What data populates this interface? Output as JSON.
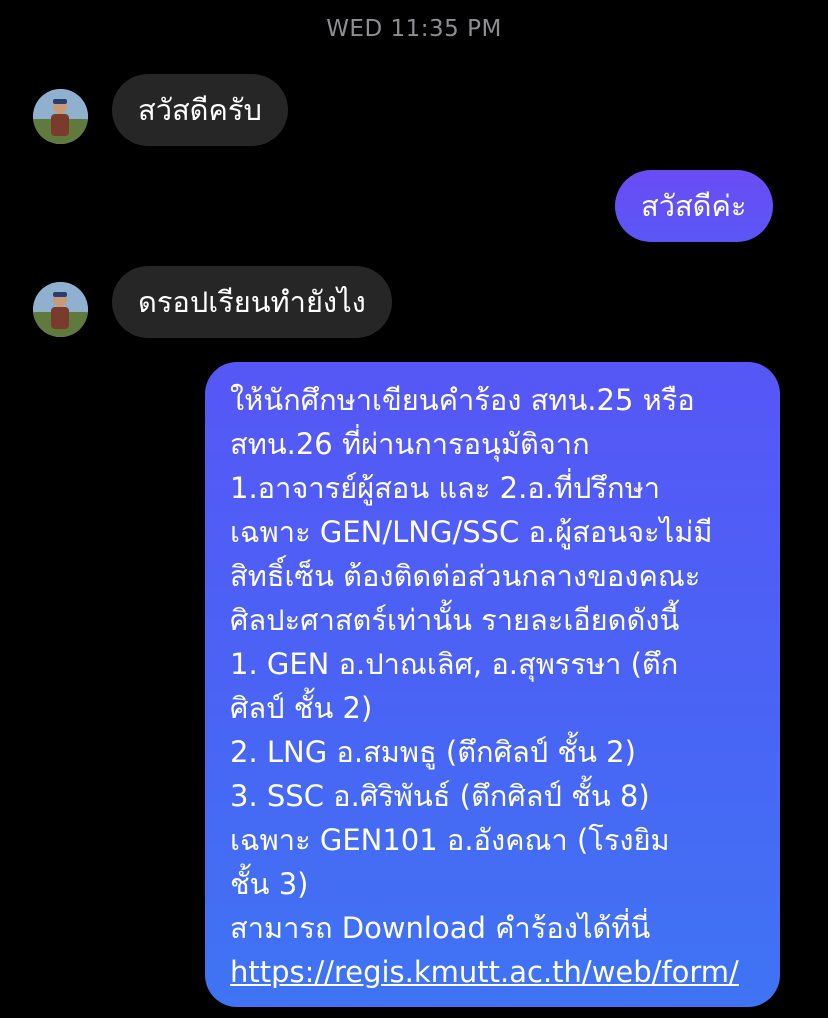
{
  "timestamp": "WED 11:35 PM",
  "messages": [
    {
      "sender": "other",
      "text": "สวัสดีครับ"
    },
    {
      "sender": "me",
      "text": "สวัสดีค่ะ"
    },
    {
      "sender": "other",
      "text": "ดรอปเรียนทำยังไง"
    },
    {
      "sender": "me",
      "lines": [
        " ให้นักศึกษาเขียนคำร้อง สทน.25 หรือ",
        "สทน.26 ที่ผ่านการอนุมัติจาก",
        "1.อาจารย์ผู้สอน และ 2.อ.ที่ปรึกษา",
        "เฉพาะ GEN/LNG/SSC อ.ผู้สอนจะไม่มี",
        "สิทธิ์เซ็น ต้องติดต่อส่วนกลางของคณะ",
        "ศิลปะศาสตร์เท่านั้น รายละเอียดดังนี้",
        "1. GEN อ.ปาณเลิศ, อ.สุพรรษา (ตึก",
        "ศิลป์ ชั้น 2)",
        "2. LNG อ.สมพธู (ตึกศิลป์ ชั้น 2)",
        "3. SSC อ.ศิริพันธ์ (ตึกศิลป์ ชั้น 8)",
        "เฉพาะ GEN101 อ.อังคณา (โรงยิม",
        "ชั้น 3)",
        "สามารถ Download คำร้องได้ที่นี่"
      ],
      "link": "https://regis.kmutt.ac.th/web/form/"
    }
  ],
  "colors": {
    "background": "#000000",
    "incoming_bubble": "#262626",
    "outgoing_gradient_top": "#6a4cf4",
    "outgoing_gradient_bottom": "#3f74f4",
    "timestamp": "#8e8e93"
  },
  "icons": {
    "avatar": "profile-photo-avatar-icon"
  }
}
